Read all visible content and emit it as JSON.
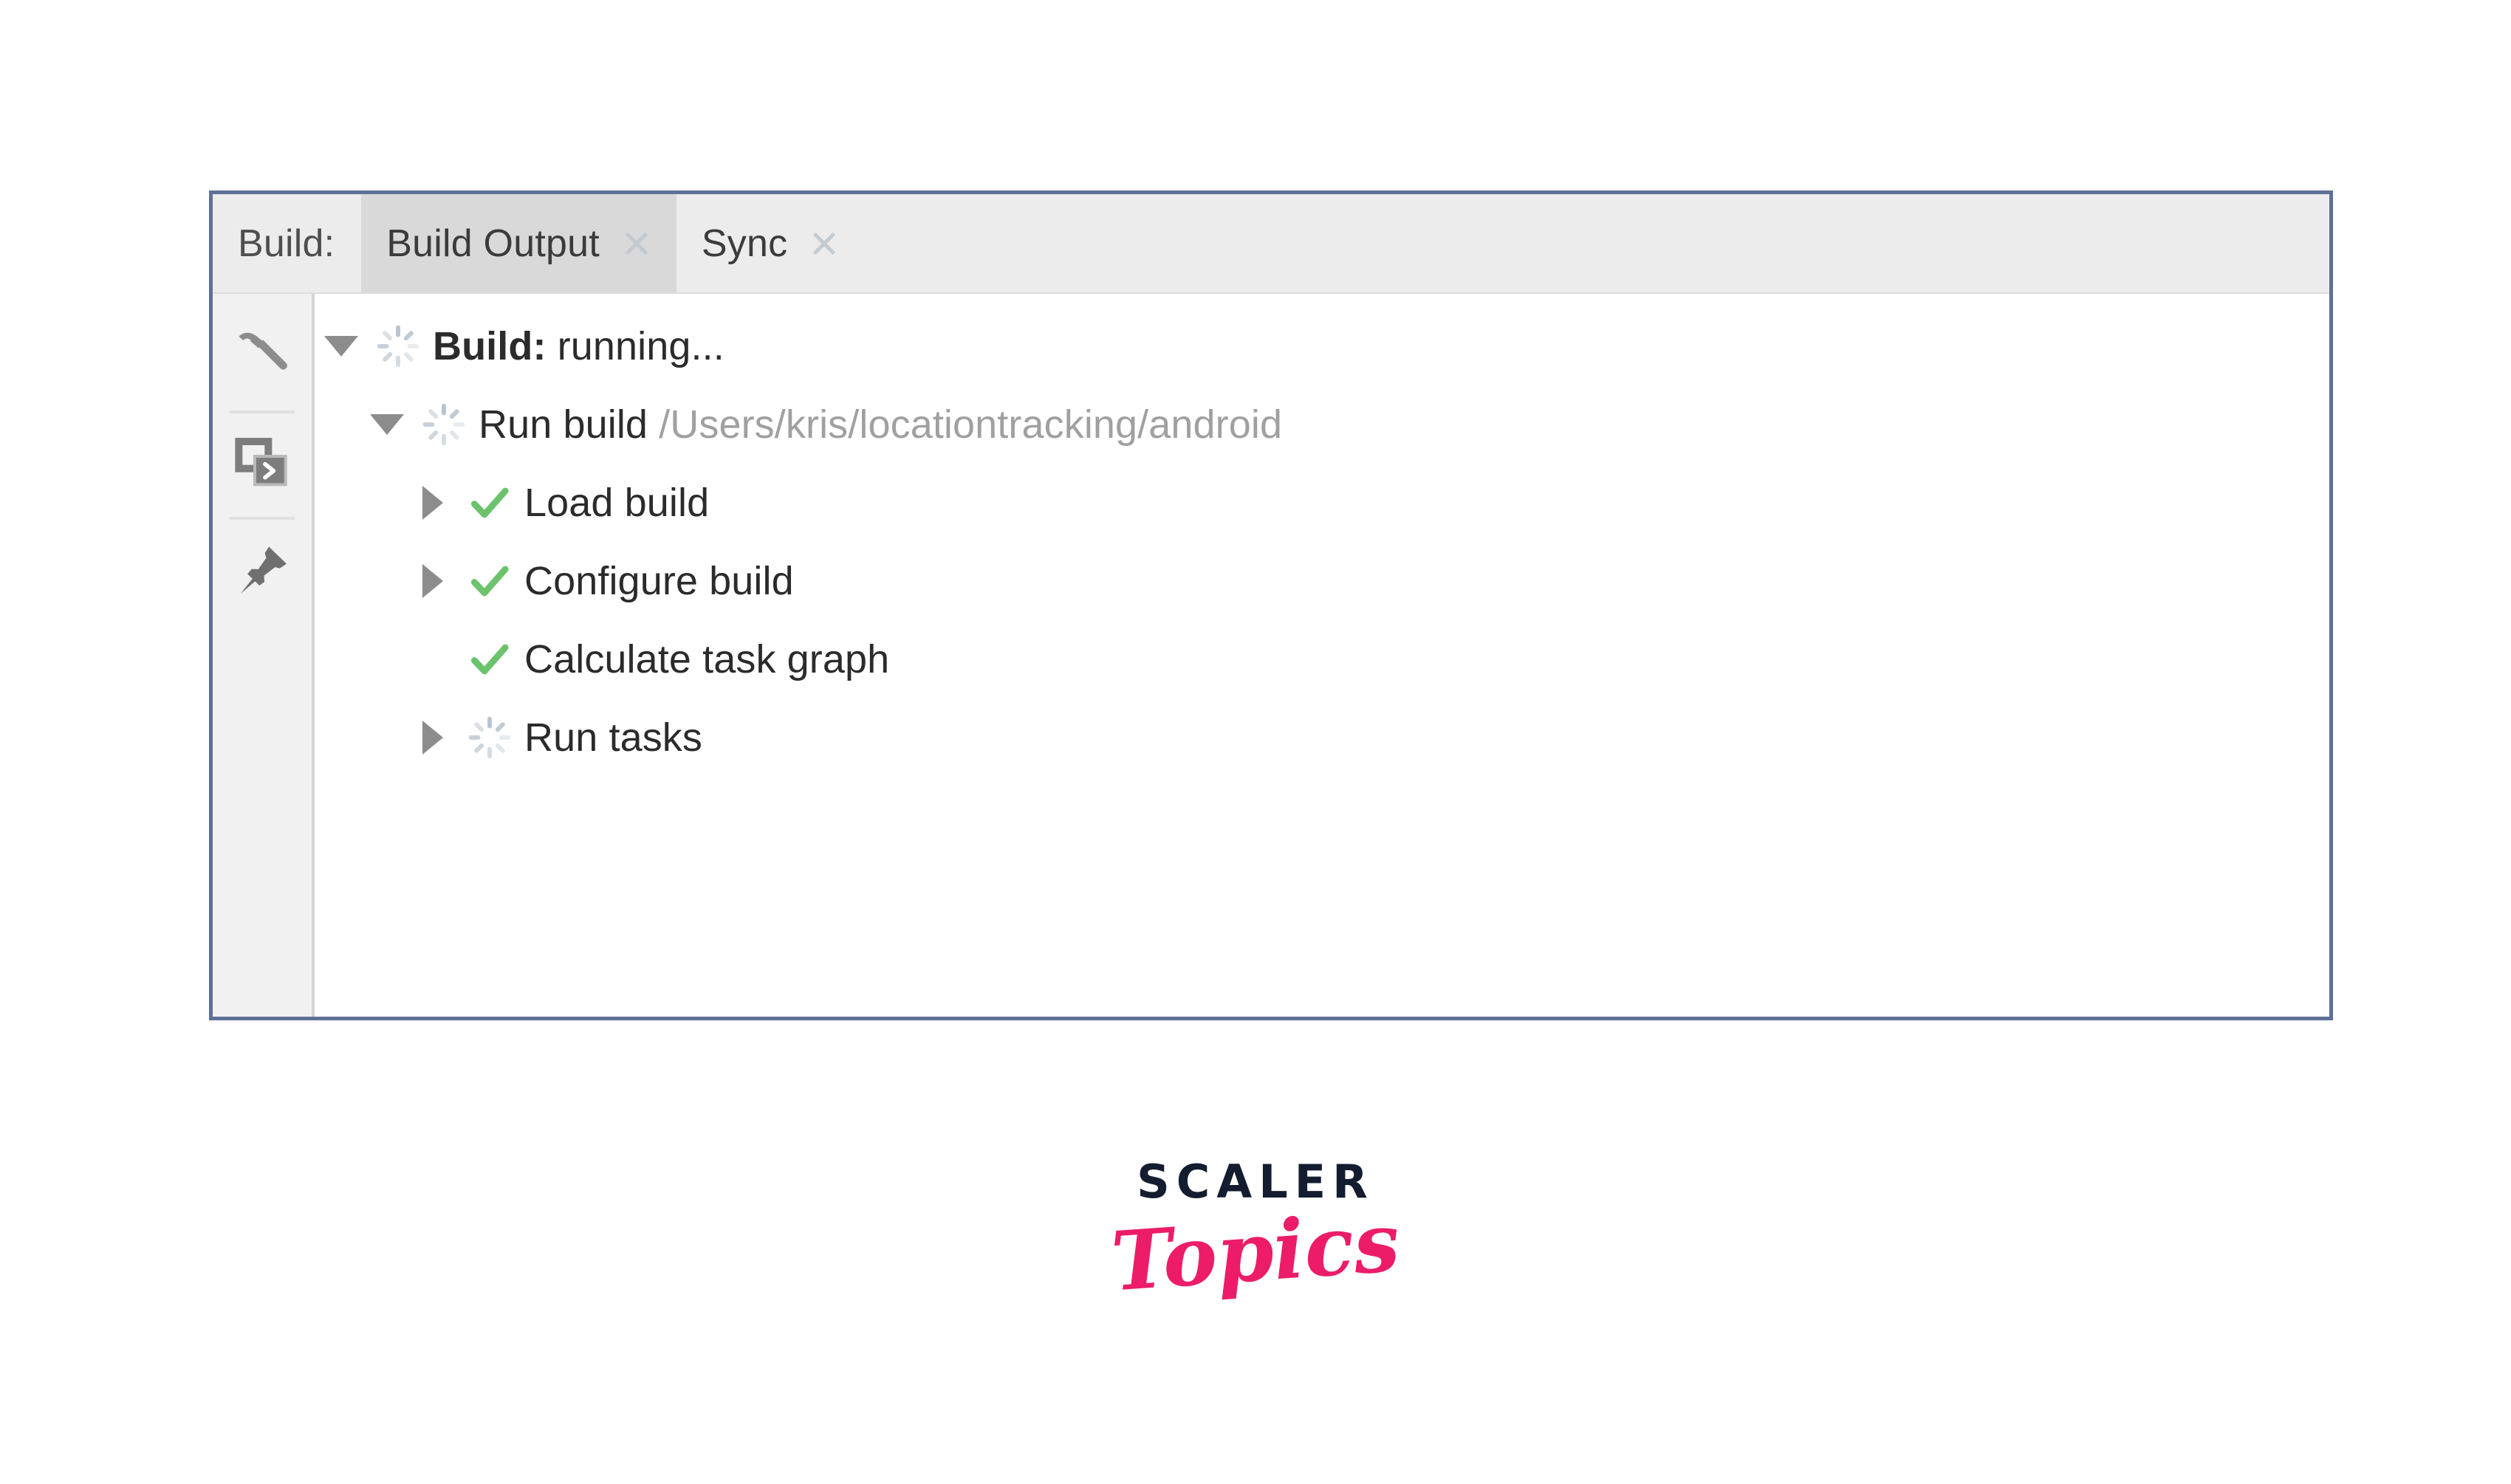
{
  "window": {
    "name": "build-tool-window",
    "border_color": "#5e7096"
  },
  "tabs_bar": {
    "group_label": "Build:",
    "tabs": [
      {
        "label": "Build Output",
        "active": true,
        "closable": true
      },
      {
        "label": "Sync",
        "active": false,
        "closable": true
      }
    ]
  },
  "side_toolbar": {
    "buttons": [
      {
        "name": "hammer-icon",
        "tooltip": "Build"
      },
      {
        "name": "console-icon",
        "tooltip": "Toggle view"
      },
      {
        "name": "pin-icon",
        "tooltip": "Pin tab"
      }
    ]
  },
  "tree": {
    "rows": [
      {
        "id": "build-root",
        "indent": 1,
        "twisty": "expanded",
        "status": "running",
        "label_bold": "Build:",
        "label": " running...",
        "label_muted": ""
      },
      {
        "id": "run-build",
        "indent": 2,
        "twisty": "expanded",
        "status": "running",
        "label_bold": "",
        "label": "Run build ",
        "label_muted": "/Users/kris/locationtracking/android"
      },
      {
        "id": "load-build",
        "indent": 3,
        "twisty": "collapsed",
        "status": "success",
        "label_bold": "",
        "label": "Load build",
        "label_muted": ""
      },
      {
        "id": "configure-build",
        "indent": 3,
        "twisty": "collapsed",
        "status": "success",
        "label_bold": "",
        "label": "Configure build",
        "label_muted": ""
      },
      {
        "id": "calculate-task-graph",
        "indent": 3,
        "twisty": "none",
        "status": "success",
        "label_bold": "",
        "label": "Calculate task graph",
        "label_muted": ""
      },
      {
        "id": "run-tasks",
        "indent": 3,
        "twisty": "collapsed",
        "status": "running",
        "label_bold": "",
        "label": "Run tasks",
        "label_muted": ""
      }
    ]
  },
  "colors": {
    "success_green": "#6cc36c",
    "spinner_gray": "#b6c2cc",
    "muted_text": "#a0a0a0",
    "tab_active_bg": "#d9d9d9",
    "tab_bar_bg": "#ececec"
  },
  "watermark": {
    "brand": "SCALER",
    "sub": "Topics",
    "brand_color": "#141c30",
    "sub_color": "#ec1c69"
  }
}
